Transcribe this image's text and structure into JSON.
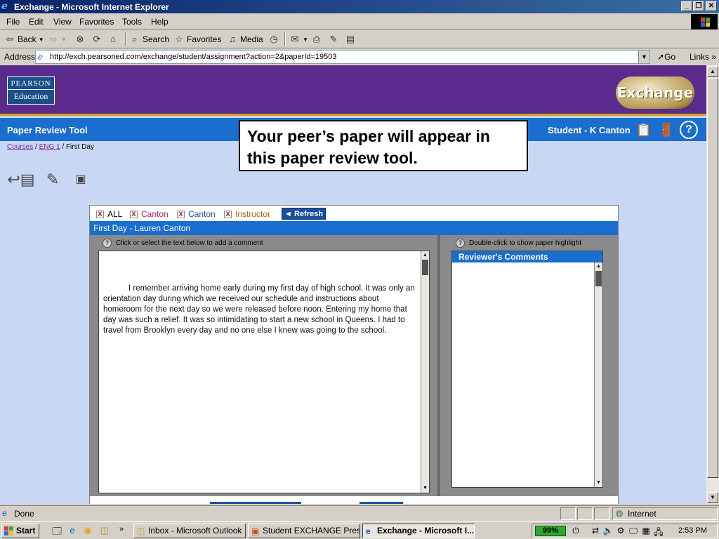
{
  "window": {
    "title": "Exchange - Microsoft Internet Explorer"
  },
  "menubar": {
    "items": [
      "File",
      "Edit",
      "View",
      "Favorites",
      "Tools",
      "Help"
    ]
  },
  "toolbar": {
    "back_label": "Back",
    "search_label": "Search",
    "favorites_label": "Favorites",
    "media_label": "Media"
  },
  "addressbar": {
    "label": "Address",
    "url": "http://exch.pearsoned.com/exchange/student/assignment?action=2&paperId=19503",
    "go_label": "Go",
    "links_label": "Links"
  },
  "site": {
    "pearson_line1": "PEARSON",
    "pearson_line2": "Education",
    "exchange_logo": "Exchange",
    "tool_title": "Paper Review Tool",
    "student_label": "Student - K Canton",
    "help_glyph": "?"
  },
  "breadcrumb": {
    "courses": "Courses",
    "sep1": " / ",
    "course": "ENG 1",
    "sep2": " / ",
    "current": "First Day"
  },
  "callout": {
    "text": "Your peer’s paper will appear in this paper review tool."
  },
  "review": {
    "filters": [
      {
        "label": "ALL",
        "color": "#000000"
      },
      {
        "label": "Canton",
        "color": "#b0207a"
      },
      {
        "label": "Canton",
        "color": "#1a4fa0"
      },
      {
        "label": "Instructor",
        "color": "#a06a00"
      }
    ],
    "refresh_label": "◄ Refresh",
    "paper_title": "First Day - Lauren Canton",
    "left_instruction": "Click or select the text below to add a comment",
    "right_instruction": "Double-click to show paper highlight",
    "paper_text": "I remember arriving home early during my first day of high school. It was only an orientation day during which we received our schedule and instructions about homeroom for the next day so we were released before noon.  Entering my home that day was such a relief.  It was so intimidating to start a new school in Queens. I had to travel from Brooklyn every day and no one else I knew was going to the school.",
    "comments_header": "Reviewer's Comments"
  },
  "statusbar": {
    "status": "Done",
    "zone": "Internet"
  },
  "taskbar": {
    "start_label": "Start",
    "tasks": [
      {
        "label": "Inbox - Microsoft Outlook"
      },
      {
        "label": "Student EXCHANGE Prese..."
      },
      {
        "label": "Exchange - Microsoft I..."
      }
    ],
    "battery": "99%",
    "clock": "2:53 PM"
  }
}
